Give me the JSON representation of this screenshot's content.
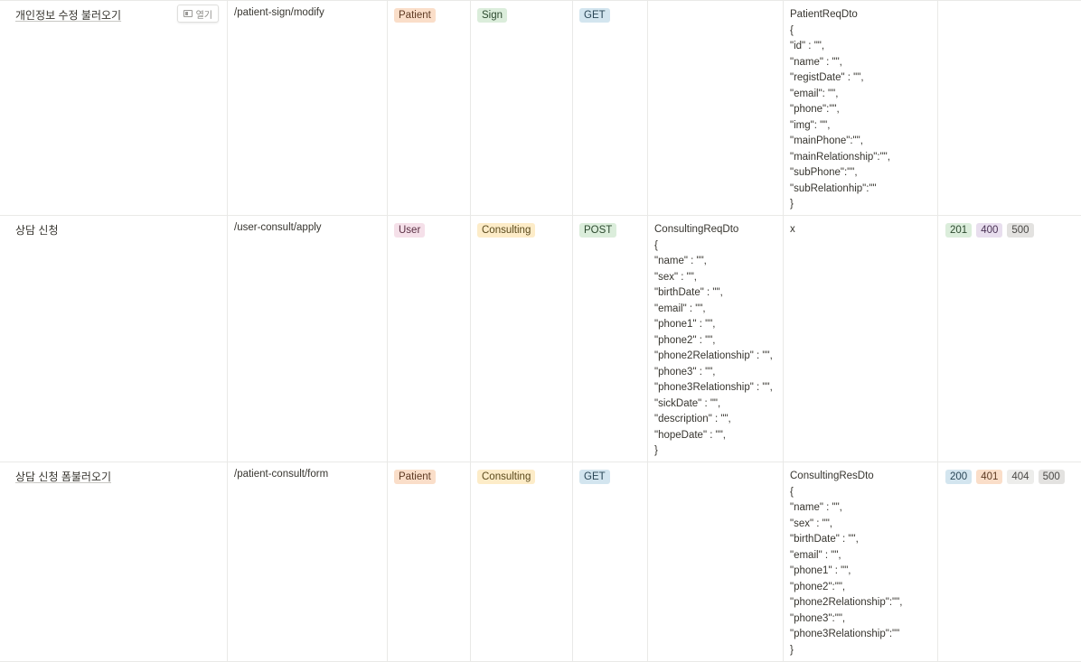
{
  "rows": [
    {
      "title": "개인정보 수정 불러오기",
      "open_label": "열기",
      "url": "/patient-sign/modify",
      "role": {
        "label": "Patient",
        "color": "orange"
      },
      "category": {
        "label": "Sign",
        "color": "green"
      },
      "method": {
        "label": "GET",
        "color": "blue"
      },
      "request": [],
      "response": [
        "PatientReqDto",
        "{",
        "\"id\" : \"\",",
        "\"name\" : \"\",",
        "\"registDate\" : \"\",",
        "\"email\": \"\",",
        "\"phone\":\"\",",
        "\"img\": \"\",",
        "\"mainPhone\":\"\",",
        "\"mainRelationship\":\"\",",
        "\"subPhone\":\"\",",
        "\"subRelationhip\":\"\"",
        "}"
      ],
      "status": []
    },
    {
      "title": "상담 신청",
      "url": "/user-consult/apply",
      "role": {
        "label": "User",
        "color": "pink"
      },
      "category": {
        "label": "Consulting",
        "color": "yellow"
      },
      "method": {
        "label": "POST",
        "color": "green"
      },
      "request": [
        "ConsultingReqDto",
        "{",
        "\"name\" : \"\",",
        "\"sex\" : \"\",",
        "\"birthDate\" : \"\",",
        "\"email\" : \"\",",
        "\"phone1\" : \"\",",
        "\"phone2\" : \"\",",
        "\"phone2Relationship\" : \"\",",
        "\"phone3\" : \"\",",
        "\"phone3Relationship\" : \"\",",
        "\"sickDate\" : \"\",",
        "\"description\" : \"\",",
        "\"hopeDate\" : \"\",",
        "}"
      ],
      "response": [
        "x"
      ],
      "status": [
        {
          "label": "201",
          "color": "green"
        },
        {
          "label": "400",
          "color": "purple"
        },
        {
          "label": "500",
          "color": "gray"
        }
      ]
    },
    {
      "title": "상담 신청 폼불러오기",
      "url": "/patient-consult/form",
      "role": {
        "label": "Patient",
        "color": "orange"
      },
      "category": {
        "label": "Consulting",
        "color": "yellow"
      },
      "method": {
        "label": "GET",
        "color": "blue"
      },
      "request": [],
      "response": [
        "ConsultingResDto",
        "{",
        "\"name\" : \"\",",
        "\"sex\" : \"\",",
        "\"birthDate\" : \"\",",
        "\"email\" : \"\",",
        "\"phone1\" : \"\",",
        "\"phone2\":\"\",",
        "\"phone2Relationship\":\"\",",
        "\"phone3\":\"\",",
        "\"phone3Relationship\":\"\"",
        "}"
      ],
      "status": [
        {
          "label": "200",
          "color": "blue"
        },
        {
          "label": "401",
          "color": "orange"
        },
        {
          "label": "404",
          "color": "lgray"
        },
        {
          "label": "500",
          "color": "gray"
        }
      ]
    }
  ]
}
